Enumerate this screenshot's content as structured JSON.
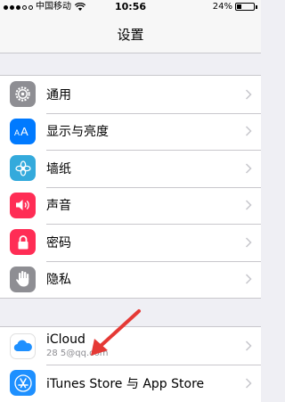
{
  "status_bar": {
    "carrier": "中国移动",
    "time": "10:56",
    "battery": "24%",
    "battery_level": 0.24,
    "signal_bars": 3
  },
  "nav": {
    "title": "设置"
  },
  "group1": [
    {
      "label": "通用",
      "icon": "gear-icon",
      "color": "#8e8e93"
    },
    {
      "label": "显示与亮度",
      "icon": "display-brightness-icon",
      "color": "#007aff"
    },
    {
      "label": "墙纸",
      "icon": "wallpaper-icon",
      "color": "#34aadc"
    },
    {
      "label": "声音",
      "icon": "speaker-icon",
      "color": "#ff2d55"
    },
    {
      "label": "密码",
      "icon": "lock-icon",
      "color": "#ff2d55"
    },
    {
      "label": "隐私",
      "icon": "hand-icon",
      "color": "#8e8e93"
    }
  ],
  "group2": [
    {
      "label": "iCloud",
      "sublabel": "28        5@qq.com",
      "icon": "icloud-icon",
      "color": "#ffffff"
    },
    {
      "label": "iTunes Store 与 App Store",
      "icon": "app-store-icon",
      "color": "#1e90ff"
    }
  ],
  "annotation": {
    "icon": "red-arrow-annotation",
    "color": "#e53935"
  }
}
